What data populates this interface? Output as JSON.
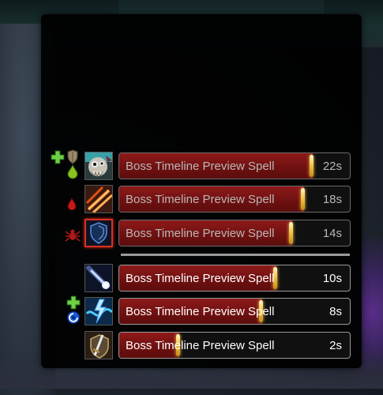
{
  "timeline": {
    "bars": [
      {
        "spell": "Boss Timeline Preview Spell",
        "time": "22s",
        "progress": 0.84,
        "active": false,
        "icon": "skull-monster-icon",
        "roles": [
          "healer-cross-icon",
          "tank-shield-icon",
          "poison-drop-icon"
        ]
      },
      {
        "spell": "Boss Timeline Preview Spell",
        "time": "18s",
        "progress": 0.8,
        "active": false,
        "icon": "claw-slash-icon",
        "roles": [
          "bleed-drop-icon"
        ]
      },
      {
        "spell": "Boss Timeline Preview Spell",
        "time": "14s",
        "progress": 0.75,
        "active": false,
        "icon": "dark-shield-icon",
        "roles": [
          "spider-icon"
        ],
        "highlighted": true
      },
      {
        "spell": "Boss Timeline Preview Spell",
        "time": "10s",
        "progress": 0.68,
        "active": true,
        "icon": "frost-comet-icon",
        "roles": []
      },
      {
        "spell": "Boss Timeline Preview Spell",
        "time": "8s",
        "progress": 0.62,
        "active": true,
        "icon": "lightning-wave-icon",
        "roles": [
          "healer-cross-icon",
          "magic-swirl-icon"
        ]
      },
      {
        "spell": "Boss Timeline Preview Spell",
        "time": "2s",
        "progress": 0.26,
        "active": true,
        "icon": "sword-shield-icon",
        "roles": []
      }
    ]
  },
  "colors": {
    "bar_fill": "#7a1212",
    "spark": "#f4c04a",
    "highlight_border": "#d9301e"
  }
}
